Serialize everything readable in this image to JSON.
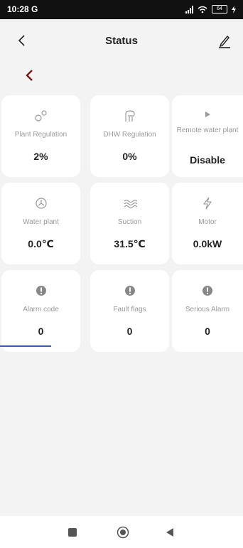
{
  "status_bar": {
    "time": "10:28 G",
    "battery": "64"
  },
  "header": {
    "title": "Status"
  },
  "cards": [
    {
      "label": "Plant Regulation",
      "value": "2%",
      "icon": "gears-icon"
    },
    {
      "label": "DHW Regulation",
      "value": "0%",
      "icon": "shower-icon"
    },
    {
      "label": "Remote water plant",
      "value": "Disable",
      "icon": "play-icon"
    },
    {
      "label": "Water plant",
      "value": "0.0℃",
      "icon": "fan-icon"
    },
    {
      "label": "Suction",
      "value": "31.5℃",
      "icon": "waves-icon"
    },
    {
      "label": "Motor",
      "value": "0.0kW",
      "icon": "lightning-icon"
    },
    {
      "label": "Alarm code",
      "value": "0",
      "icon": "alert-icon"
    },
    {
      "label": "Fault flags",
      "value": "0",
      "icon": "alert-icon"
    },
    {
      "label": "Serious Alarm",
      "value": "0",
      "icon": "alert-icon"
    }
  ],
  "colors": {
    "background": "#f3f3f3",
    "card": "#ffffff",
    "back_accent": "#7a1a1a",
    "annotation": "#3a5fa8"
  }
}
